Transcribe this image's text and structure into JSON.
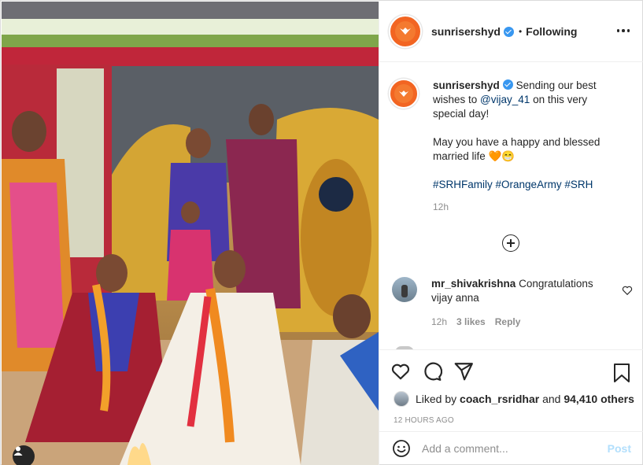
{
  "post": {
    "username": "sunrisershyd",
    "follow_separator": "•",
    "follow_status": "Following",
    "more_icon": "more-horizontal-icon"
  },
  "caption": {
    "username": "sunrisershyd",
    "text_1": "Sending our best wishes to",
    "mention": "@vijay_41",
    "text_2": "on this very special day!",
    "text_3": "May you have a happy and blessed married life",
    "emoji": "🧡😁",
    "tags": [
      "#SRHFamily",
      "#OrangeArmy",
      "#SRH"
    ],
    "time": "12h"
  },
  "comment": {
    "username": "mr_shivakrishna",
    "text": "Congratulations vijay anna",
    "time": "12h",
    "likes": "3 likes",
    "reply": "Reply"
  },
  "likes": {
    "prefix": "Liked by",
    "user": "coach_rsridhar",
    "and": "and",
    "count": "94,410 others"
  },
  "timestamp": "12 HOURS AGO",
  "comment_box": {
    "placeholder": "Add a comment...",
    "post_label": "Post"
  },
  "colors": {
    "brand_orange": "#f26522",
    "link": "#00376b",
    "verified": "#3897f0",
    "muted": "#8e8e8e"
  }
}
